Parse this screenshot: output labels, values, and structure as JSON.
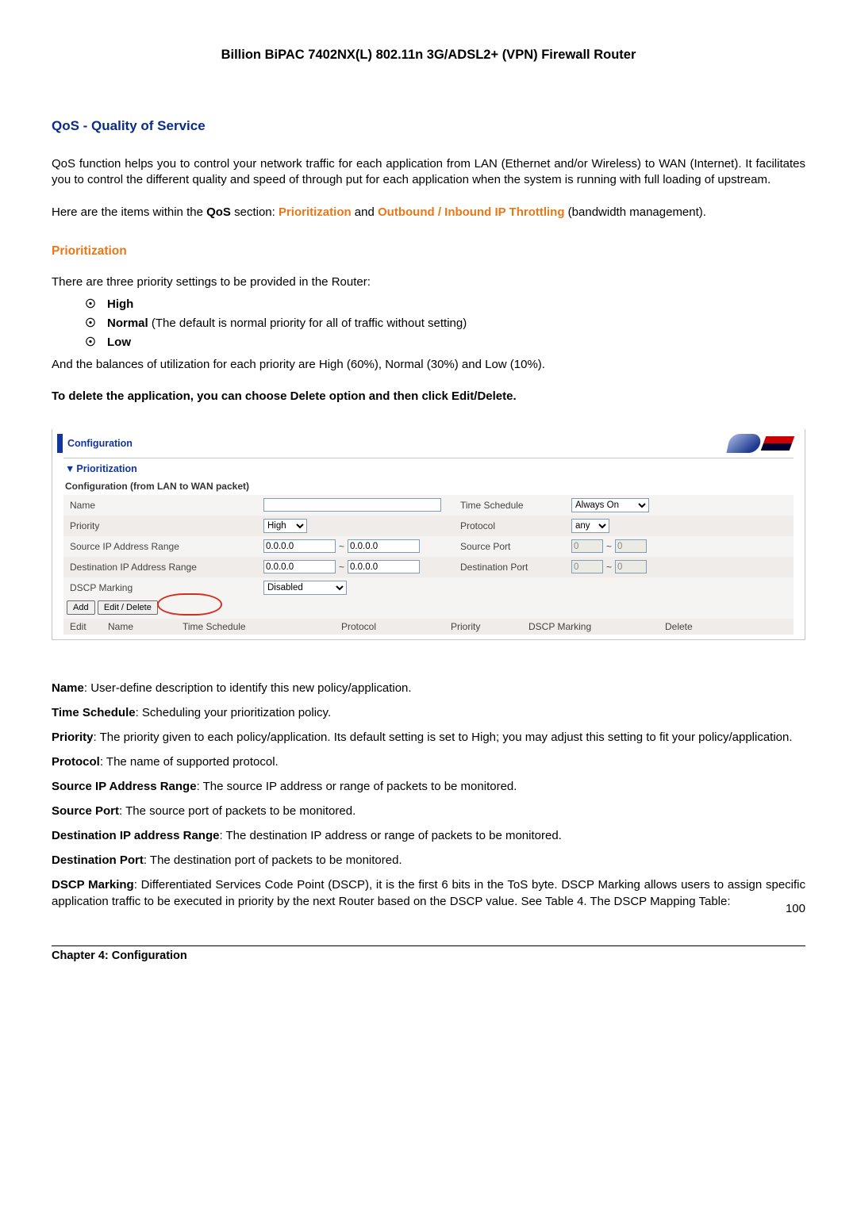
{
  "doc_title": "Billion BiPAC 7402NX(L) 802.11n 3G/ADSL2+ (VPN) Firewall Router",
  "section_heading": "QoS - Quality of Service",
  "para1": "QoS function helps you to control your network traffic for each application from LAN (Ethernet and/or Wireless) to WAN (Internet).    It facilitates you to control the different quality and speed of through put for each application when the system is running with full loading of upstream.",
  "para2_pre": "Here are the items within the ",
  "para2_bold": "QoS",
  "para2_mid": " section: ",
  "para2_link1": "Prioritization",
  "para2_and": " and ",
  "para2_link2": "Outbound / Inbound IP Throttling",
  "para2_post": " (bandwidth management).",
  "sub_heading": "Prioritization",
  "para3": "There are three priority settings to be provided in the Router:",
  "bullets": {
    "high": "High",
    "normal_pre": "Normal",
    "normal_rest": " (The default is normal priority for all of traffic without setting)",
    "low": "Low"
  },
  "para4": "And the balances of utilization for each priority are High (60%), Normal (30%) and Low (10%).",
  "para5": "To delete the application, you can choose Delete option and then click Edit/Delete.",
  "panel": {
    "header": "Configuration",
    "section_title": "Prioritization",
    "sub": "Configuration (from LAN to WAN packet)",
    "labels": {
      "name": "Name",
      "time_schedule": "Time Schedule",
      "priority": "Priority",
      "protocol": "Protocol",
      "src_ip": "Source IP Address Range",
      "src_port": "Source Port",
      "dst_ip": "Destination IP Address Range",
      "dst_port": "Destination Port",
      "dscp": "DSCP Marking"
    },
    "values": {
      "name": "",
      "time_schedule": "Always On",
      "priority": "High",
      "protocol": "any",
      "src_ip_from": "0.0.0.0",
      "src_ip_to": "0.0.0.0",
      "src_port_from": "0",
      "src_port_to": "0",
      "dst_ip_from": "0.0.0.0",
      "dst_ip_to": "0.0.0.0",
      "dst_port_from": "0",
      "dst_port_to": "0",
      "dscp": "Disabled"
    },
    "buttons": {
      "add": "Add",
      "edit_delete": "Edit / Delete"
    },
    "thead": {
      "edit": "Edit",
      "name": "Name",
      "ts": "Time Schedule",
      "proto": "Protocol",
      "prio": "Priority",
      "dscp": "DSCP Marking",
      "del": "Delete"
    }
  },
  "defs": {
    "name": {
      "t": "Name",
      "d": ": User-define description to identify this new policy/application."
    },
    "ts": {
      "t": "Time Schedule",
      "d": ": Scheduling your prioritization policy."
    },
    "prio": {
      "t": "Priority",
      "d": ": The priority given to each policy/application. Its default setting is set to High; you may adjust this setting to fit your policy/application."
    },
    "proto": {
      "t": "Protocol",
      "d": ": The name of supported protocol."
    },
    "sip": {
      "t": "Source IP Address Range",
      "d": ": The source IP address or range of packets to be monitored."
    },
    "sport": {
      "t": "Source Port",
      "d": ": The source port of packets to be monitored."
    },
    "dip": {
      "t": "Destination IP address Range",
      "d": ": The destination IP address or range of packets to be monitored."
    },
    "dport": {
      "t": "Destination Port",
      "d": ": The destination port of packets to be monitored."
    },
    "dscp": {
      "t": "DSCP Marking",
      "d": ": Differentiated Services Code Point (DSCP), it is the first 6 bits in the ToS byte. DSCP Marking allows users to assign specific application traffic to be executed in priority by the next Router based on the DSCP value.    See Table 4. The DSCP Mapping Table:"
    }
  },
  "footer": {
    "chapter": "Chapter 4: Configuration",
    "page": "100"
  }
}
